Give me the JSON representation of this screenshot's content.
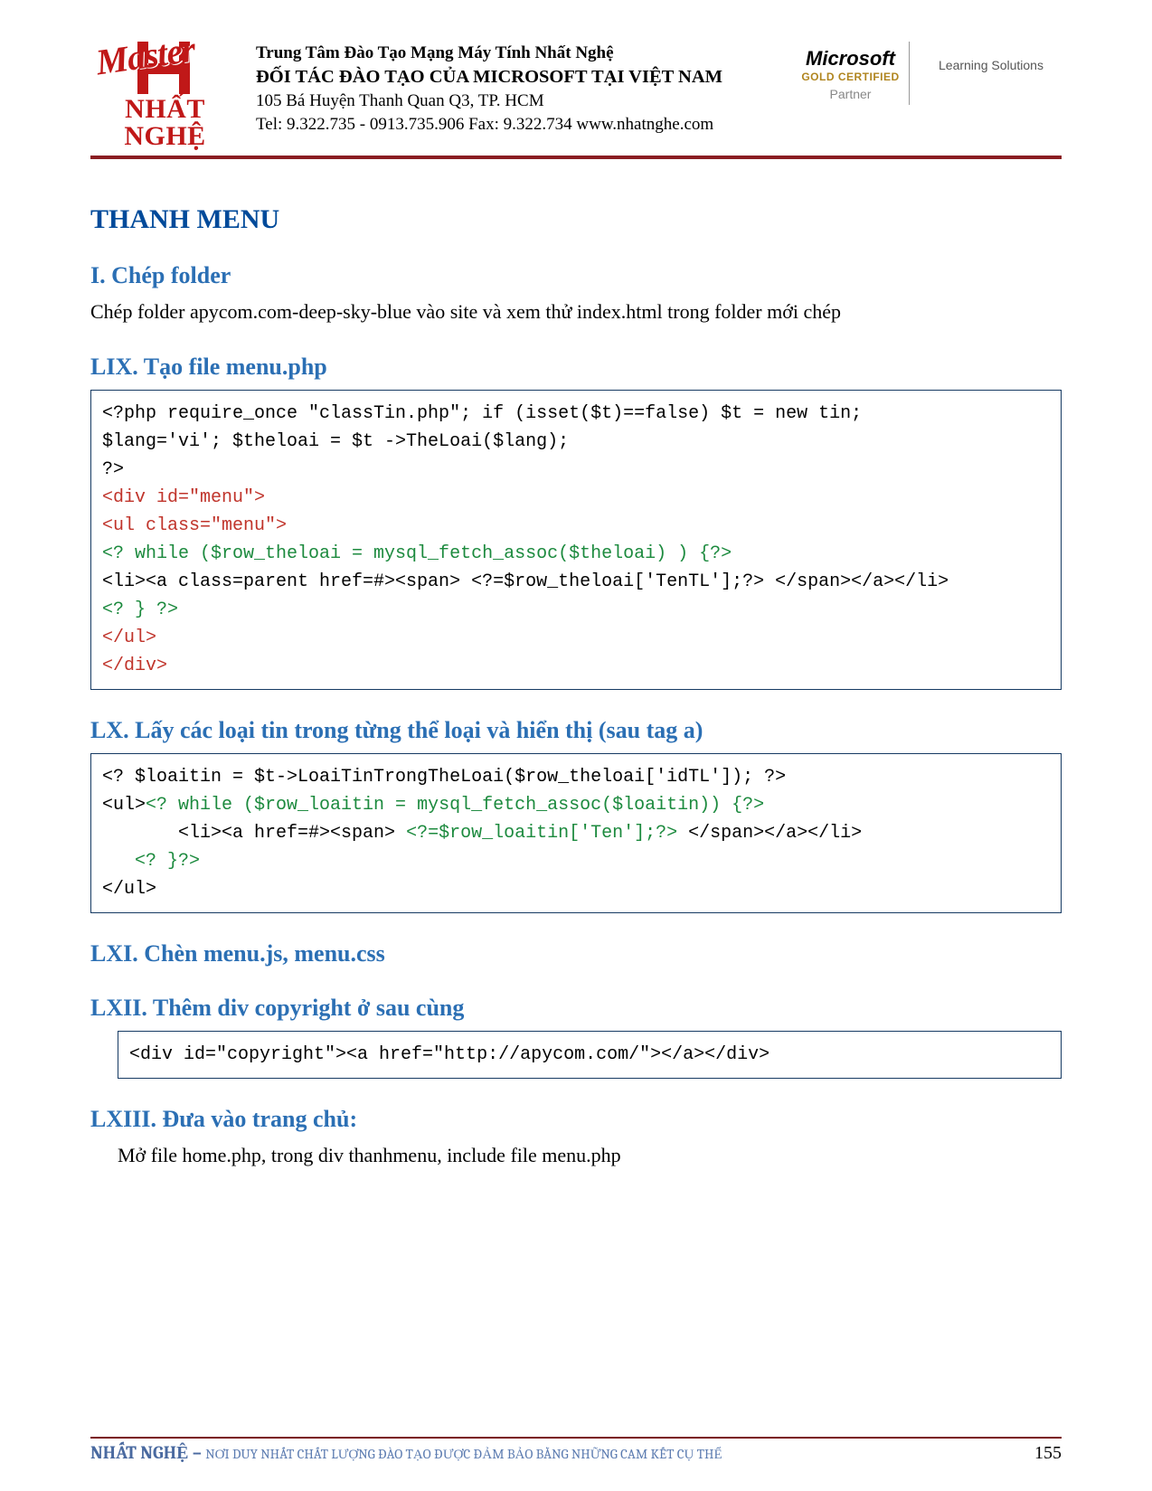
{
  "header": {
    "logo_script": "Master",
    "logo_text": "NHẤT NGHỆ",
    "line1": "Trung Tâm Đào Tạo Mạng Máy Tính Nhất Nghệ",
    "line2": "ĐỐI TÁC ĐÀO TẠO CỦA MICROSOFT TẠI VIỆT NAM",
    "line3": "105 Bá Huyện Thanh Quan Q3, TP. HCM",
    "line4": "Tel: 9.322.735 - 0913.735.906 Fax: 9.322.734 www.nhatnghe.com",
    "ms_logo": "Microsoft",
    "ms_gold": "GOLD CERTIFIED",
    "ms_partner": "Partner",
    "learning": "Learning Solutions"
  },
  "title": "THANH MENU",
  "sections": {
    "s1": {
      "heading": "I. Chép folder",
      "body": "Chép folder apycom.com-deep-sky-blue vào site và xem thử index.html trong folder mới chép"
    },
    "s2": {
      "heading": "LIX. Tạo file menu.php",
      "code": {
        "l1": "<?php require_once \"classTin.php\"; if (isset($t)==false) $t = new tin;",
        "l2": "$lang='vi'; $theloai = $t ->TheLoai($lang);",
        "l3": "?>",
        "l4": "<div id=\"menu\">",
        "l5": "<ul class=\"menu\">",
        "l6": "<? while ($row_theloai = mysql_fetch_assoc($theloai) ) {?>",
        "l7": "<li><a class=parent href=#><span> <?=$row_theloai['TenTL'];?> </span></a></li>",
        "l8": "<? } ?>",
        "l9": "</ul>",
        "l10": "</div>"
      }
    },
    "s3": {
      "heading": "LX. Lấy các loại tin trong từng thể loại và hiển thị (sau tag a)",
      "code": {
        "l1": "<? $loaitin = $t->LoaiTinTrongTheLoai($row_theloai['idTL']); ?>",
        "l2a": "<ul>",
        "l2b": "<? while ($row_loaitin = mysql_fetch_assoc($loaitin)) {?>",
        "l3a": "       <li><a href=#><span> ",
        "l3b": "<?=$row_loaitin['Ten'];?>",
        "l3c": " </span></a></li>",
        "l4": "   <? }?>",
        "l5": "</ul>"
      }
    },
    "s4": {
      "heading": "LXI. Chèn menu.js, menu.css"
    },
    "s5": {
      "heading": "LXII. Thêm div copyright ở sau cùng",
      "code": "<div id=\"copyright\"><a href=\"http://apycom.com/\"></a></div>"
    },
    "s6": {
      "heading": "LXIII. Đưa vào trang chủ:",
      "body": "Mở file home.php, trong div thanhmenu, include file menu.php"
    }
  },
  "footer": {
    "brand": "NHẤT NGHỆ",
    "dash": " – ",
    "tagline": "NƠI DUY NHẤT CHẤT LƯỢNG ĐÀO TẠO ĐƯỢC ĐẢM BẢO BẰNG NHỮNG CAM KẾT CỤ THỂ",
    "page": "155"
  }
}
